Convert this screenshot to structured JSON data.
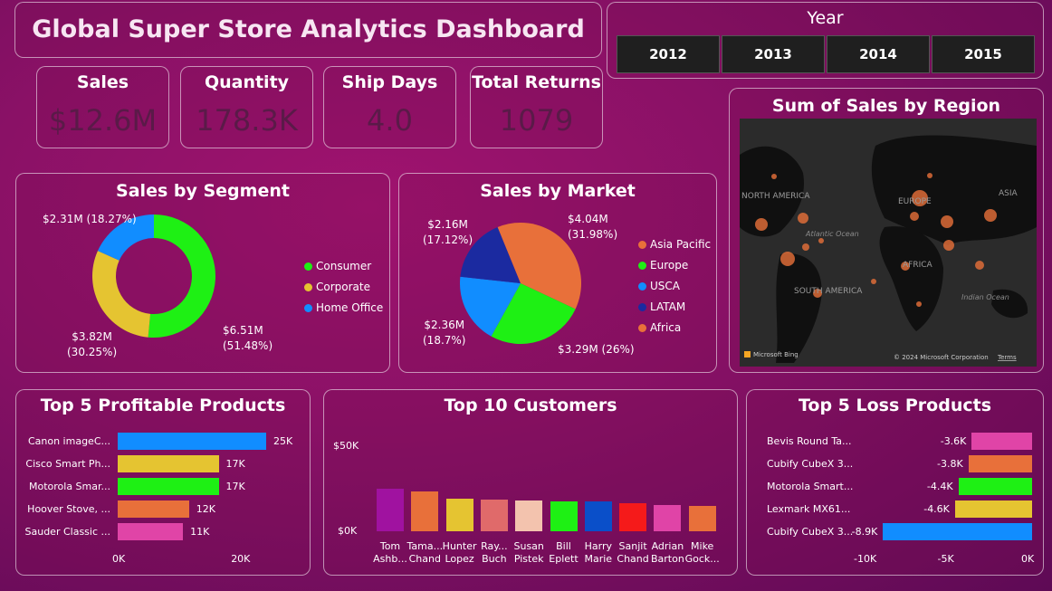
{
  "header": {
    "title": "Global Super Store Analytics Dashboard"
  },
  "year_slicer": {
    "label": "Year",
    "years": [
      "2012",
      "2013",
      "2014",
      "2015"
    ]
  },
  "kpis": [
    {
      "label": "Sales",
      "value": "$12.6M"
    },
    {
      "label": "Quantity",
      "value": "178.3K"
    },
    {
      "label": "Ship Days",
      "value": "4.0"
    },
    {
      "label": "Total Returns",
      "value": "1079"
    }
  ],
  "map": {
    "title": "Sum of Sales by Region",
    "labels": [
      "NORTH AMERICA",
      "EUROPE",
      "ASIA",
      "Atlantic Ocean",
      "AFRICA",
      "SOUTH AMERICA",
      "Indian Ocean"
    ],
    "attribution": "Microsoft Bing",
    "copyright": "© 2024 Microsoft Corporation",
    "terms": "Terms"
  },
  "colors": {
    "green": "#1ef014",
    "yellow": "#e5c431",
    "blue": "#118dff",
    "navy": "#1b2aa0",
    "orange": "#e8703a",
    "pink": "#e044a7"
  },
  "chart_data": [
    {
      "type": "pie",
      "variant": "donut",
      "title": "Sales by Segment",
      "series": [
        {
          "name": "Consumer",
          "value": 6.51,
          "label": "$6.51M",
          "pct": "(51.48%)",
          "color": "#1ef014"
        },
        {
          "name": "Corporate",
          "value": 3.82,
          "label": "$3.82M",
          "pct": "(30.25%)",
          "color": "#e5c431"
        },
        {
          "name": "Home Office",
          "value": 2.31,
          "label": "$2.31M",
          "pct": "(18.27%)",
          "color": "#118dff"
        }
      ],
      "legend": "right"
    },
    {
      "type": "pie",
      "title": "Sales by Market",
      "series": [
        {
          "name": "Asia Pacific",
          "value": 4.04,
          "label": "$4.04M",
          "pct": "(31.98%)",
          "color": "#e8703a"
        },
        {
          "name": "Europe",
          "value": 3.29,
          "label": "$3.29M",
          "pct": "(26%)",
          "color": "#1ef014"
        },
        {
          "name": "USCA",
          "value": 2.36,
          "label": "$2.36M",
          "pct": "(18.7%)",
          "color": "#118dff"
        },
        {
          "name": "LATAM",
          "value": 2.16,
          "label": "$2.16M",
          "pct": "(17.12%)",
          "color": "#1b2aa0"
        },
        {
          "name": "Africa",
          "value": 0.78,
          "label": "",
          "pct": "",
          "color": "#e8703a"
        }
      ],
      "legend": "right"
    },
    {
      "type": "bar",
      "orientation": "horizontal",
      "title": "Top 5 Profitable Products",
      "categories": [
        "Canon imageC...",
        "Cisco Smart Ph...",
        "Motorola Smar...",
        "Hoover Stove, ...",
        "Sauder Classic ..."
      ],
      "values": [
        25,
        17,
        17,
        12,
        11
      ],
      "value_labels": [
        "25K",
        "17K",
        "17K",
        "12K",
        "11K"
      ],
      "colors": [
        "#118dff",
        "#e5c431",
        "#1ef014",
        "#e8703a",
        "#e044a7"
      ],
      "xticks": [
        "0K",
        "20K"
      ],
      "xlim": [
        0,
        25
      ]
    },
    {
      "type": "bar",
      "title": "Top 10 Customers",
      "categories": [
        "Tom Ashb...",
        "Tama... Chand",
        "Hunter Lopez",
        "Ray... Buch",
        "Susan Pistek",
        "Bill Eplett",
        "Harry Marie",
        "Sanjit Chand",
        "Adrian Barton",
        "Mike Gock..."
      ],
      "category_lines": [
        [
          "Tom",
          "Ashb..."
        ],
        [
          "Tama...",
          "Chand"
        ],
        [
          "Hunter",
          "Lopez"
        ],
        [
          "Ray...",
          "Buch"
        ],
        [
          "Susan",
          "Pistek"
        ],
        [
          "Bill",
          "Eplett"
        ],
        [
          "Harry",
          "Marie"
        ],
        [
          "Sanjit",
          "Chand"
        ],
        [
          "Adrian",
          "Barton"
        ],
        [
          "Mike",
          "Gock..."
        ]
      ],
      "values": [
        25,
        23,
        19,
        18.5,
        18,
        17.5,
        17.5,
        16.5,
        15.5,
        14.5
      ],
      "colors": [
        "#a012a0",
        "#e8703a",
        "#e5c431",
        "#e06a6a",
        "#f3c3ae",
        "#1ef014",
        "#0a4fc9",
        "#f51a1a",
        "#e044a7",
        "#e8703a"
      ],
      "yticks": [
        "$50K",
        "$0K"
      ],
      "ylim": [
        0,
        50
      ]
    },
    {
      "type": "bar",
      "orientation": "horizontal",
      "title": "Top 5 Loss Products",
      "categories": [
        "Bevis Round Ta...",
        "Cubify CubeX 3...",
        "Motorola Smart...",
        "Lexmark MX61...",
        "Cubify CubeX 3..."
      ],
      "values": [
        -3.6,
        -3.8,
        -4.4,
        -4.6,
        -8.9
      ],
      "value_labels": [
        "-3.6K",
        "-3.8K",
        "-4.4K",
        "-4.6K",
        "-8.9K"
      ],
      "colors": [
        "#e044a7",
        "#e8703a",
        "#1ef014",
        "#e5c431",
        "#118dff"
      ],
      "xticks": [
        "-10K",
        "-5K",
        "0K"
      ],
      "xlim": [
        -10,
        0
      ]
    }
  ]
}
